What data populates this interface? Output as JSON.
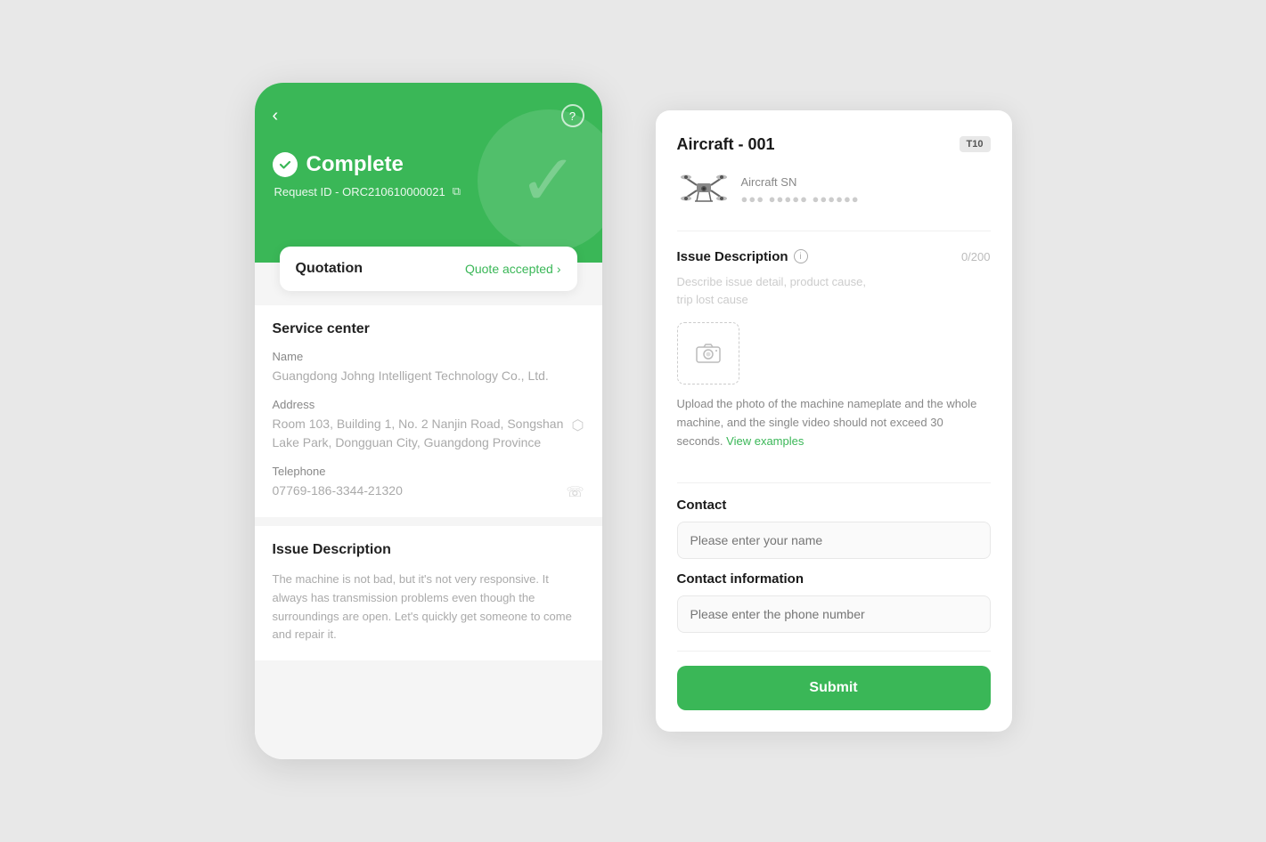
{
  "leftCard": {
    "header": {
      "backIcon": "‹",
      "helpIcon": "?",
      "completeTitle": "Complete",
      "requestId": "Request ID - ORC210610000021",
      "bgCheckmark": "✓"
    },
    "quotation": {
      "label": "Quotation",
      "status": "Quote accepted",
      "arrow": "›"
    },
    "serviceCenter": {
      "title": "Service center",
      "nameLabel": "Name",
      "nameValue": "Guangdong Johng Intelligent Technology Co., Ltd.",
      "addressLabel": "Address",
      "addressValue": "Room 103, Building 1, No. 2 Nanjin Road, Songshan Lake Park, Dongguan City, Guangdong Province",
      "telephoneLabel": "Telephone",
      "telephoneValue": "07769-186-3344-21320"
    },
    "issueDescription": {
      "title": "Issue Description",
      "text": "The machine is not bad, but it's not very responsive. It always has transmission problems even though the surroundings are open. Let's quickly get someone to come and repair it."
    }
  },
  "rightPanel": {
    "aircraft": {
      "title": "Aircraft  - 001",
      "badge": "T10",
      "snLabel": "Aircraft SN",
      "snValue": "●●● ●●●●● ●●●●●●"
    },
    "issueDescription": {
      "title": "Issue Description",
      "infoIcon": "i",
      "charCount": "0/200",
      "placeholderLine1": "Describe issue detail, product cause,",
      "placeholderLine2": "trip lost cause",
      "uploadHintMain": "Upload the photo of the machine nameplate and the whole machine, and the single video should not exceed 30 seconds.",
      "viewExamples": "View examples"
    },
    "contact": {
      "label": "Contact",
      "placeholder": "Please enter your name"
    },
    "contactInfo": {
      "label": "Contact information",
      "placeholder": "Please enter the phone number"
    },
    "submitButton": "Submit"
  }
}
